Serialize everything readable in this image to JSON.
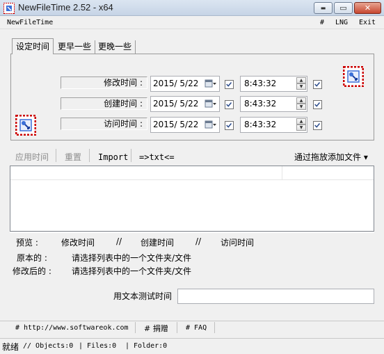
{
  "window": {
    "title": "NewFileTime 2.52 - x64",
    "min_glyph": "▬",
    "max_glyph": "▭",
    "close_glyph": "✕"
  },
  "menu": {
    "app_name": "NewFileTime",
    "hash": "#",
    "lng": "LNG",
    "exit": "Exit"
  },
  "tabs": [
    {
      "label": "设定时间"
    },
    {
      "label": "更早一些"
    },
    {
      "label": "更晚一些"
    }
  ],
  "times": [
    {
      "label": "修改时间 :",
      "date": "2015/  5/22",
      "time": "8:43:32",
      "date_checked": true,
      "time_checked": true
    },
    {
      "label": "创建时间 :",
      "date": "2015/  5/22",
      "time": "8:43:32",
      "date_checked": true,
      "time_checked": true
    },
    {
      "label": "访问时间 :",
      "date": "2015/  5/22",
      "time": "8:43:32",
      "date_checked": true,
      "time_checked": true
    }
  ],
  "toolbar": {
    "apply": "应用时间",
    "reset": "重置",
    "import": "Import",
    "to_txt": "=>txt<=",
    "drop_add": "通过拖放添加文件 ▾"
  },
  "preview": {
    "preview_label": "预览 :",
    "modified": "修改时间",
    "sep1": "//",
    "created": "创建时间",
    "sep2": "//",
    "accessed": "访问时间",
    "original_label": "原本的 :",
    "original_value": "请选择列表中的一个文件夹/文件",
    "modified_label": "修改后的 :",
    "modified_value": "请选择列表中的一个文件夹/文件"
  },
  "test": {
    "label": "用文本测试时间",
    "value": ""
  },
  "footer": {
    "website": "# http://www.softwareok.com",
    "donate": "# 捐赠",
    "faq": "# FAQ"
  },
  "status": {
    "ready": "就绪",
    "objects": "// Objects:0",
    "files": "| Files:0",
    "folder": "| Folder:0"
  },
  "colors": {
    "accent": "#d0021b",
    "disabled_text": "#8c8c8c"
  }
}
